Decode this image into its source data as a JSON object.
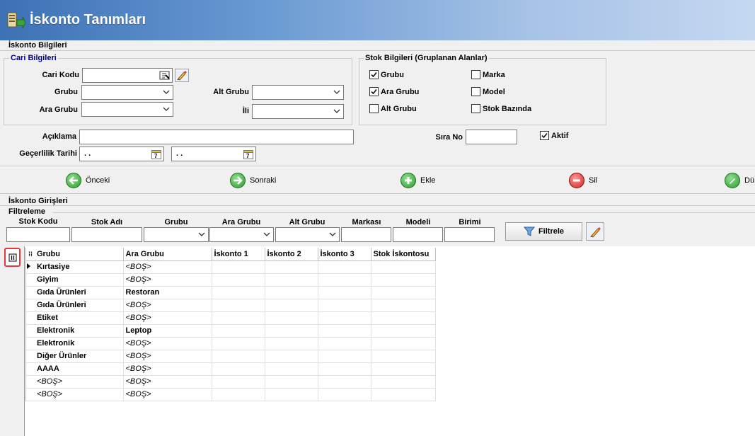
{
  "window": {
    "title": "İskonto Tanımları"
  },
  "iskonto_bilgileri": {
    "title": "İskonto Bilgileri",
    "cari": {
      "title": "Cari Bilgileri",
      "cari_kodu_label": "Cari Kodu",
      "cari_kodu_value": "",
      "grubu_label": "Grubu",
      "grubu_value": "",
      "ara_grubu_label": "Ara Grubu",
      "ara_grubu_value": "",
      "alt_grubu_label": "Alt Grubu",
      "alt_grubu_value": "",
      "ili_label": "İli",
      "ili_value": ""
    },
    "stok": {
      "title": "Stok Bilgileri (Gruplanan Alanlar)",
      "checks": [
        {
          "label": "Grubu",
          "checked": true
        },
        {
          "label": "Ara Grubu",
          "checked": true
        },
        {
          "label": "Alt Grubu",
          "checked": false
        },
        {
          "label": "Marka",
          "checked": false
        },
        {
          "label": "Model",
          "checked": false
        },
        {
          "label": "Stok Bazında",
          "checked": false
        }
      ]
    },
    "aciklama_label": "Açıklama",
    "aciklama_value": "",
    "gecerlilik_label": "Geçerlilik Tarihi",
    "date1": ". .",
    "date2": ". .",
    "sira_no_label": "Sıra No",
    "sira_no_value": "",
    "aktif_label": "Aktif",
    "aktif_checked": true
  },
  "toolbar": {
    "onceki": "Önceki",
    "sonraki": "Sonraki",
    "ekle": "Ekle",
    "sil": "Sil",
    "duzenle": "Dü"
  },
  "girisleri": {
    "title": "İskonto Girişleri",
    "filtreleme": "Filtreleme",
    "filters": {
      "stok_kodu": "Stok Kodu",
      "stok_adi": "Stok Adı",
      "grubu": "Grubu",
      "ara_grubu": "Ara Grubu",
      "alt_grubu": "Alt Grubu",
      "markasi": "Markası",
      "modeli": "Modeli",
      "birimi": "Birimi"
    },
    "filtrele_button": "Filtrele"
  },
  "grid": {
    "columns": [
      "Grubu",
      "Ara Grubu",
      "İskonto 1",
      "İskonto 2",
      "İskonto 3",
      "Stok İskontosu"
    ],
    "rows": [
      [
        "Kırtasiye",
        "<BOŞ>"
      ],
      [
        "Giyim",
        "<BOŞ>"
      ],
      [
        "Gıda Ürünleri",
        "Restoran"
      ],
      [
        "Gıda Ürünleri",
        "<BOŞ>"
      ],
      [
        "Etiket",
        "<BOŞ>"
      ],
      [
        "Elektronik",
        "Leptop"
      ],
      [
        "Elektronik",
        "<BOŞ>"
      ],
      [
        "Diğer Ürünler",
        "<BOŞ>"
      ],
      [
        "AAAA",
        "<BOŞ>"
      ],
      [
        "<BOŞ>",
        "<BOŞ>"
      ],
      [
        "<BOŞ>",
        "<BOŞ>"
      ]
    ]
  }
}
